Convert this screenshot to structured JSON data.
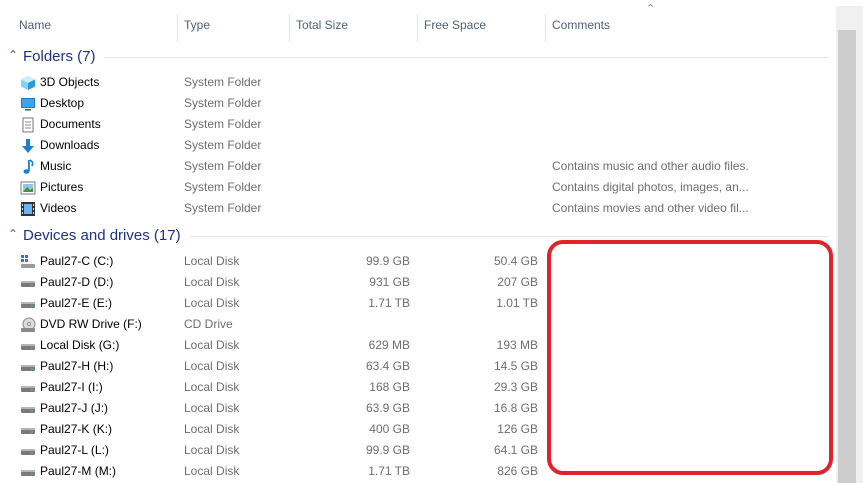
{
  "columns": {
    "name": "Name",
    "type": "Type",
    "total_size": "Total Size",
    "free_space": "Free Space",
    "comments": "Comments"
  },
  "groups": {
    "folders": {
      "title": "Folders (7)"
    },
    "devices": {
      "title": "Devices and drives (17)"
    }
  },
  "folders": [
    {
      "name": "3D Objects",
      "type": "System Folder",
      "comment": "",
      "icon": "3d-objects-icon"
    },
    {
      "name": "Desktop",
      "type": "System Folder",
      "comment": "",
      "icon": "desktop-icon"
    },
    {
      "name": "Documents",
      "type": "System Folder",
      "comment": "",
      "icon": "documents-icon"
    },
    {
      "name": "Downloads",
      "type": "System Folder",
      "comment": "",
      "icon": "downloads-icon"
    },
    {
      "name": "Music",
      "type": "System Folder",
      "comment": "Contains music and other audio files.",
      "icon": "music-icon"
    },
    {
      "name": "Pictures",
      "type": "System Folder",
      "comment": "Contains digital photos, images, an...",
      "icon": "pictures-icon"
    },
    {
      "name": "Videos",
      "type": "System Folder",
      "comment": "Contains movies and other video fil...",
      "icon": "videos-icon"
    }
  ],
  "drives": [
    {
      "name": "Paul27-C (C:)",
      "type": "Local Disk",
      "total": "99.9 GB",
      "free": "50.4 GB",
      "icon": "system-drive-icon"
    },
    {
      "name": "Paul27-D (D:)",
      "type": "Local Disk",
      "total": "931 GB",
      "free": "207 GB",
      "icon": "hard-drive-icon"
    },
    {
      "name": "Paul27-E (E:)",
      "type": "Local Disk",
      "total": "1.71 TB",
      "free": "1.01 TB",
      "icon": "hard-drive-icon"
    },
    {
      "name": "DVD RW Drive (F:)",
      "type": "CD Drive",
      "total": "",
      "free": "",
      "icon": "dvd-drive-icon"
    },
    {
      "name": "Local Disk (G:)",
      "type": "Local Disk",
      "total": "629 MB",
      "free": "193 MB",
      "icon": "hard-drive-icon"
    },
    {
      "name": "Paul27-H (H:)",
      "type": "Local Disk",
      "total": "63.4 GB",
      "free": "14.5 GB",
      "icon": "hard-drive-icon"
    },
    {
      "name": "Paul27-I (I:)",
      "type": "Local Disk",
      "total": "168 GB",
      "free": "29.3 GB",
      "icon": "hard-drive-icon"
    },
    {
      "name": "Paul27-J (J:)",
      "type": "Local Disk",
      "total": "63.9 GB",
      "free": "16.8 GB",
      "icon": "hard-drive-icon"
    },
    {
      "name": "Paul27-K (K:)",
      "type": "Local Disk",
      "total": "400 GB",
      "free": "126 GB",
      "icon": "hard-drive-icon"
    },
    {
      "name": "Paul27-L (L:)",
      "type": "Local Disk",
      "total": "99.9 GB",
      "free": "64.1 GB",
      "icon": "hard-drive-icon"
    },
    {
      "name": "Paul27-M (M:)",
      "type": "Local Disk",
      "total": "1.71 TB",
      "free": "826 GB",
      "icon": "hard-drive-icon"
    }
  ],
  "colors": {
    "group_title": "#1e3287",
    "header_text": "#4c607a",
    "secondary_text": "#6d6d6d",
    "highlight_border": "#e3212b"
  }
}
